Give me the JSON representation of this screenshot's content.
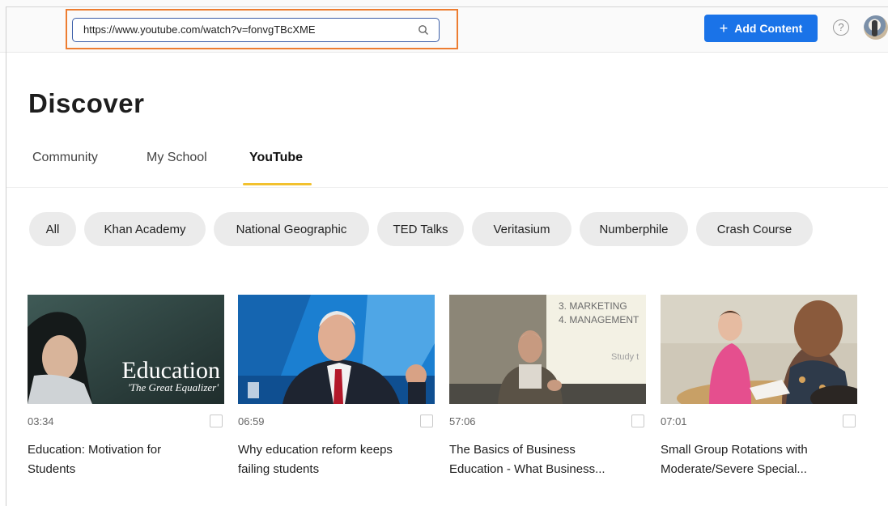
{
  "search": {
    "url": "https://www.youtube.com/watch?v=fonvgTBcXME"
  },
  "header": {
    "add_content_label": "Add Content",
    "help_glyph": "?"
  },
  "page": {
    "title": "Discover"
  },
  "tabs": [
    {
      "label": "Community",
      "active": false
    },
    {
      "label": "My School",
      "active": false
    },
    {
      "label": "YouTube",
      "active": true
    }
  ],
  "chips": [
    "All",
    "Khan Academy",
    "National Geographic",
    "TED Talks",
    "Veritasium",
    "Numberphile",
    "Crash Course"
  ],
  "videos": [
    {
      "duration": "03:34",
      "title_line1": "Education: Motivation for",
      "title_line2": "Students",
      "thumb_text_main": "Education",
      "thumb_text_sub": "'The Great Equalizer'"
    },
    {
      "duration": "06:59",
      "title_line1": "Why education reform keeps",
      "title_line2": "failing students"
    },
    {
      "duration": "57:06",
      "title_line1": "The Basics of Business",
      "title_line2": "Education - What Business...",
      "slide_line1": "3. MARKETING",
      "slide_line2": "4. MANAGEMENT",
      "slide_line3": "Study t"
    },
    {
      "duration": "07:01",
      "title_line1": "Small Group Rotations with",
      "title_line2": "Moderate/Severe Special..."
    }
  ],
  "colors": {
    "accent": "#1a73e8",
    "highlight": "#ed7d31",
    "tab_underline": "#f2c12e"
  }
}
